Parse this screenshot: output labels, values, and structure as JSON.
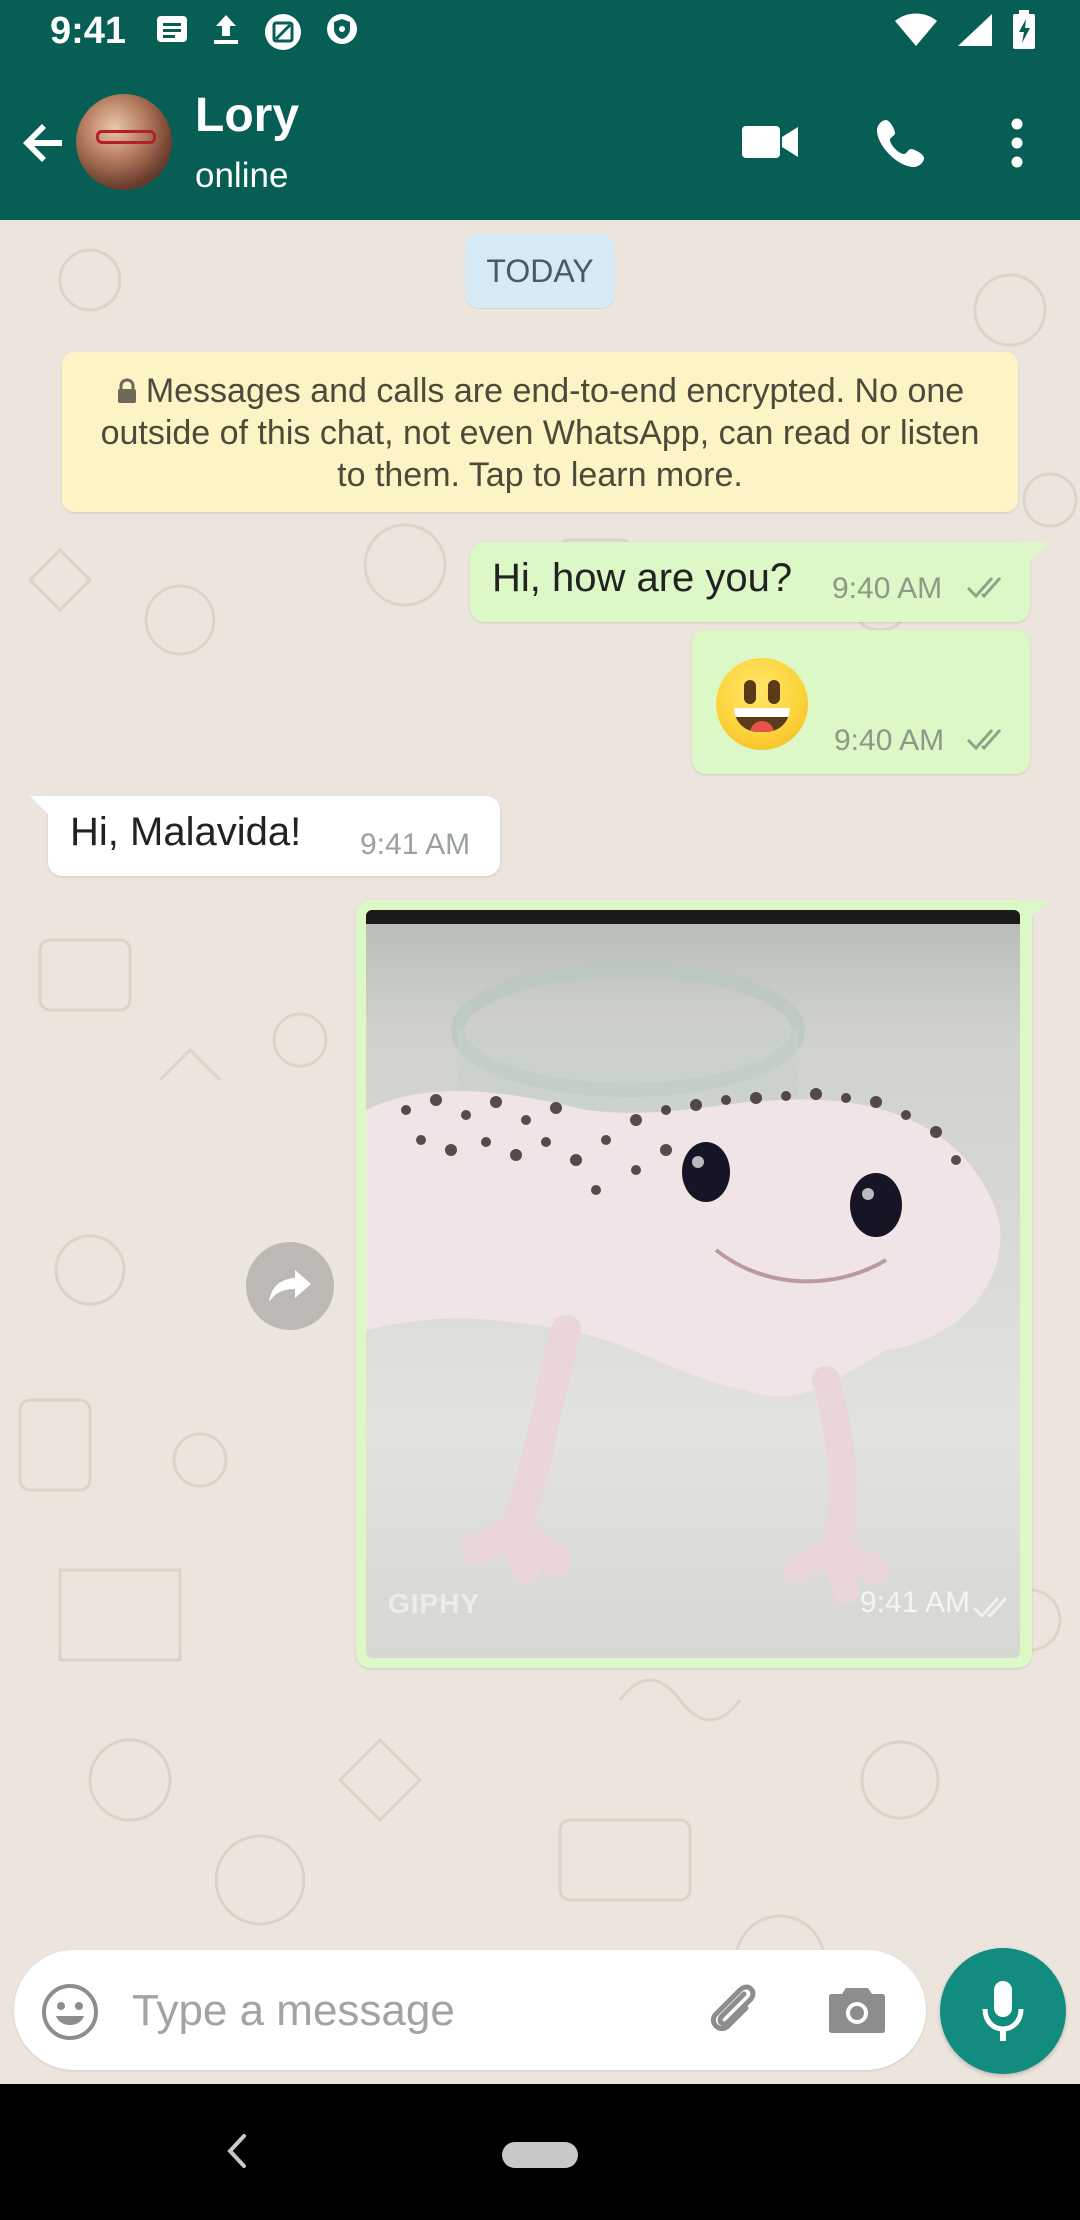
{
  "status_bar": {
    "time": "9:41"
  },
  "header": {
    "contact_name": "Lory",
    "contact_status": "online"
  },
  "chat": {
    "date_chip": "TODAY",
    "encryption_notice": "Messages and calls are end-to-end encrypted. No one outside of this chat, not even WhatsApp, can read or listen to them. Tap to learn more.",
    "messages": [
      {
        "direction": "outgoing",
        "text": "Hi, how are you?",
        "time": "9:40 AM",
        "status": "read"
      },
      {
        "direction": "outgoing",
        "emoji": "grinning-face",
        "time": "9:40 AM",
        "status": "read"
      },
      {
        "direction": "incoming",
        "text": "Hi, Malavida!",
        "time": "9:41 AM"
      },
      {
        "direction": "outgoing",
        "media": "gif",
        "watermark": "GIPHY",
        "time": "9:41 AM",
        "status": "read"
      }
    ]
  },
  "composer": {
    "placeholder": "Type a message"
  },
  "icons": {
    "back": "back-arrow-icon",
    "video": "video-call-icon",
    "call": "phone-icon",
    "menu": "more-vert-icon",
    "emoji": "emoji-icon",
    "attach": "paperclip-icon",
    "camera": "camera-icon",
    "mic": "mic-icon",
    "forward": "forward-icon"
  },
  "colors": {
    "header": "#075e54",
    "outgoing_bubble": "#dcf8c6",
    "incoming_bubble": "#ffffff",
    "notice": "#fcf4c5",
    "date_chip": "#d6eaf5",
    "mic_button": "#128c7e",
    "chat_background": "#ece5dd"
  }
}
